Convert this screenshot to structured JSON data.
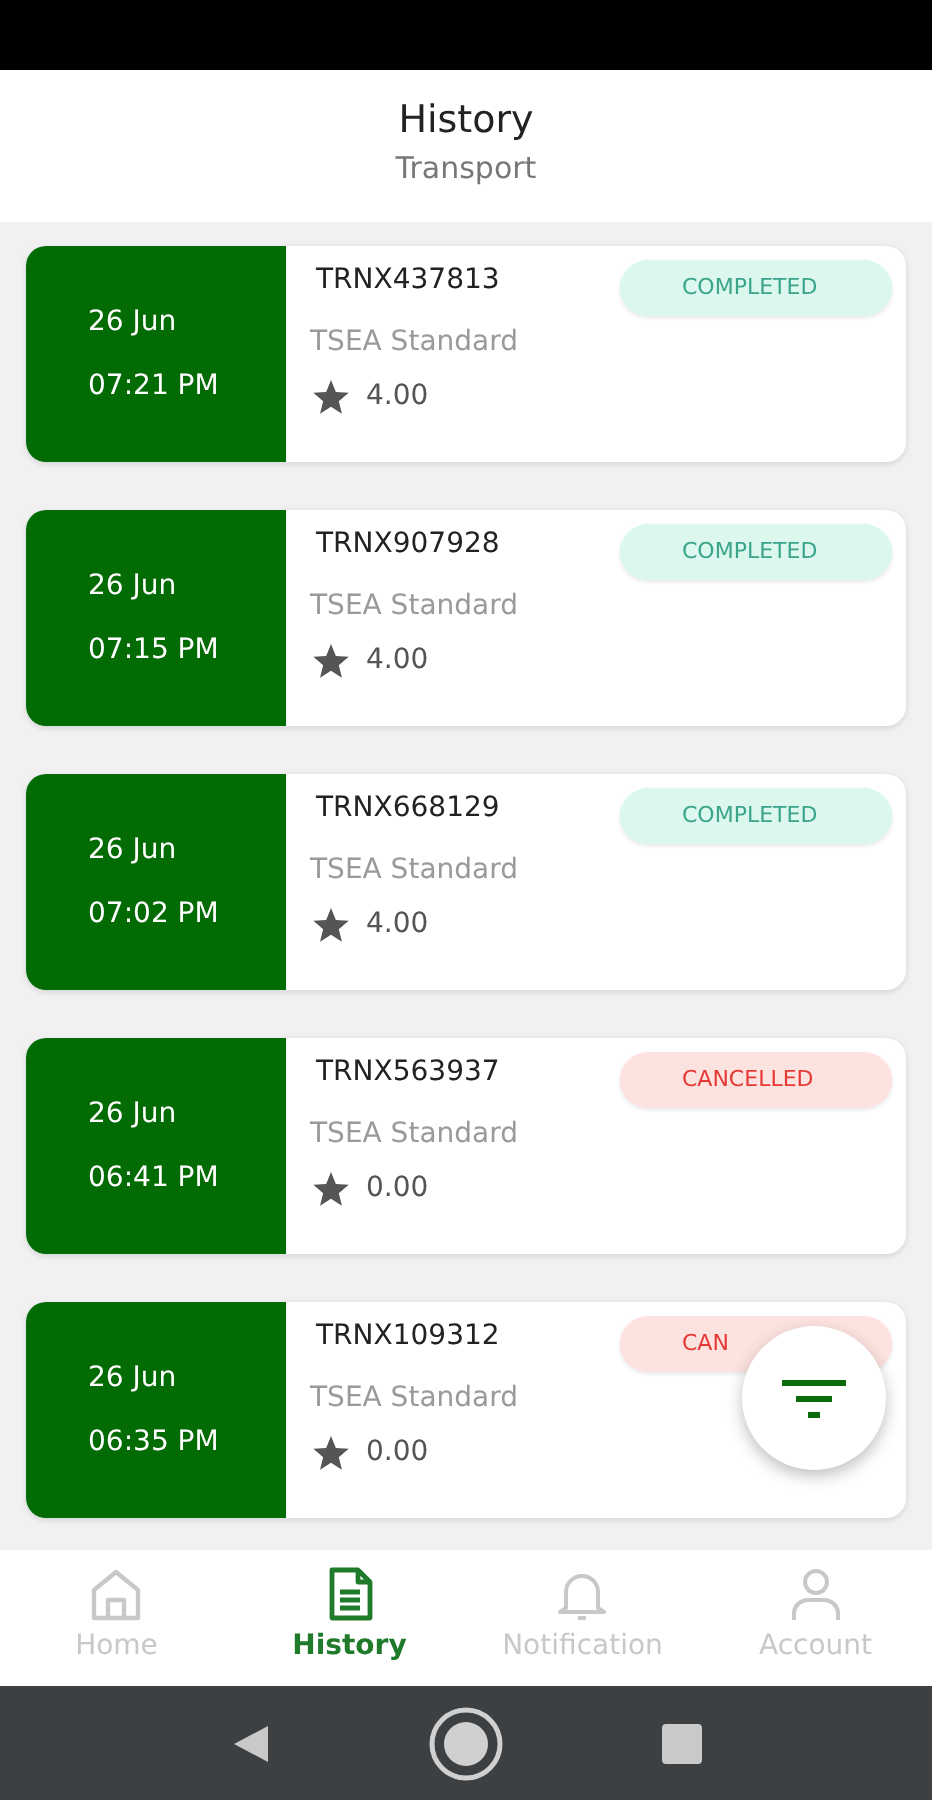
{
  "header": {
    "title": "History",
    "subtitle": "Transport"
  },
  "transactions": [
    {
      "date": "26 Jun",
      "time": "07:21 PM",
      "id": "TRNX437813",
      "service": "TSEA Standard",
      "rating": "4.00",
      "status": {
        "kind": "completed",
        "label": "COMPLETED"
      }
    },
    {
      "date": "26 Jun",
      "time": "07:15 PM",
      "id": "TRNX907928",
      "service": "TSEA Standard",
      "rating": "4.00",
      "status": {
        "kind": "completed",
        "label": "COMPLETED"
      }
    },
    {
      "date": "26 Jun",
      "time": "07:02 PM",
      "id": "TRNX668129",
      "service": "TSEA Standard",
      "rating": "4.00",
      "status": {
        "kind": "completed",
        "label": "COMPLETED"
      }
    },
    {
      "date": "26 Jun",
      "time": "06:41 PM",
      "id": "TRNX563937",
      "service": "TSEA Standard",
      "rating": "0.00",
      "status": {
        "kind": "cancelled",
        "label": "CANCELLED"
      }
    },
    {
      "date": "26 Jun",
      "time": "06:35 PM",
      "id": "TRNX109312",
      "service": "TSEA Standard",
      "rating": "0.00",
      "status": {
        "kind": "cancelled",
        "label": "CAN"
      }
    }
  ],
  "bottom_nav": [
    {
      "kind": "home",
      "label": "Home",
      "selected": false
    },
    {
      "kind": "history",
      "label": "History",
      "selected": true
    },
    {
      "kind": "notification",
      "label": "Notification",
      "selected": false
    },
    {
      "kind": "account",
      "label": "Account",
      "selected": false
    }
  ]
}
